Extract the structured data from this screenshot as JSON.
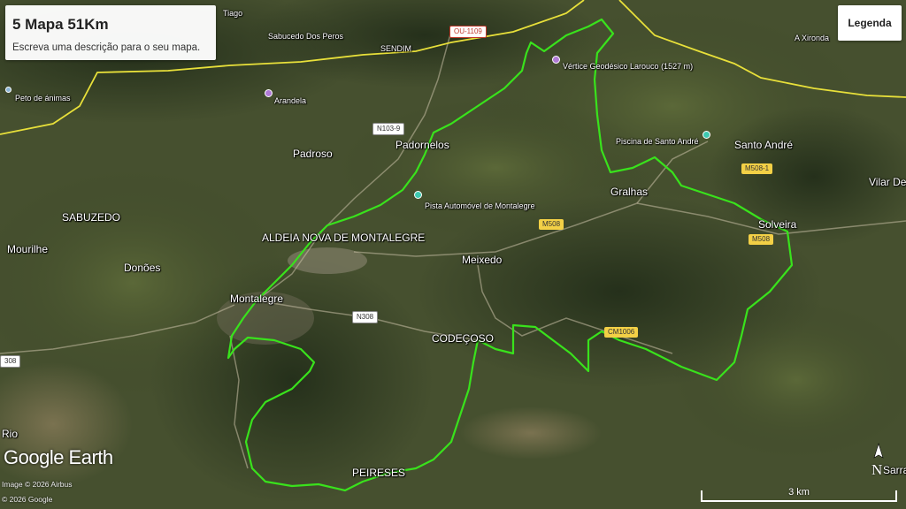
{
  "map": {
    "title": "5 Mapa 51Km",
    "description": "Escreva uma descrição para o seu mapa.",
    "legend_button": "Legenda",
    "brand": "Google Earth",
    "credits": [
      "Image © 2026 Airbus",
      "© 2026 Google"
    ],
    "scale_label": "3 km",
    "compass_label": "N",
    "colors": {
      "route": "#39e21c",
      "border": "#e8e03a",
      "poi_purple": "#b07ad6",
      "poi_teal": "#3ec9b0"
    },
    "places": [
      {
        "name": "Sabucedo Dos Peros"
      },
      {
        "name": "SENDIM"
      },
      {
        "name": "Tiago"
      },
      {
        "name": "A Xironda"
      },
      {
        "name": "Peto de ánimas"
      },
      {
        "name": "Arandela"
      },
      {
        "name": "Vértice Geodésico Larouco (1527 m)"
      },
      {
        "name": "Padornelos"
      },
      {
        "name": "Padroso"
      },
      {
        "name": "Piscina de Santo André"
      },
      {
        "name": "Santo André"
      },
      {
        "name": "Gralhas"
      },
      {
        "name": "Solveira"
      },
      {
        "name": "Vilar De"
      },
      {
        "name": "SABUZEDO"
      },
      {
        "name": "Pista Automóvel de Montalegre"
      },
      {
        "name": "ALDEIA NOVA DE MONTALEGRE"
      },
      {
        "name": "Mourilhe"
      },
      {
        "name": "Donões"
      },
      {
        "name": "Meixedo"
      },
      {
        "name": "Montalegre"
      },
      {
        "name": "CODEÇOSO"
      },
      {
        "name": "PEIRESES"
      },
      {
        "name": "Rio"
      },
      {
        "name": "Sarra"
      }
    ],
    "roads": [
      "OU-1109",
      "N103-9",
      "M508-1",
      "M508",
      "M508",
      "N308",
      "CM1006",
      "308"
    ]
  }
}
